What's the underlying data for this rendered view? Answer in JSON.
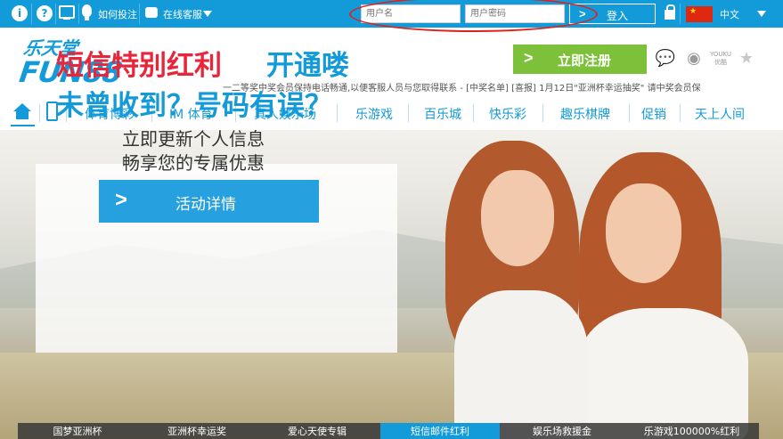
{
  "topbar": {
    "howto_label": "如何投注",
    "support_label": "在线客服",
    "username_placeholder": "用户名",
    "password_placeholder": "用户密码",
    "login_label": "登入",
    "language_label": "中文"
  },
  "header": {
    "logo_top": "乐天堂",
    "logo_main": "FUN88",
    "register_label": "立即注册",
    "youku_label": "YOUKU\n优酷",
    "marquee": "一二等奖中奖会员保持电话畅通,以便客服人员与您取得联系 - [中奖名单]      [喜报] 1月12日\"亚洲杯幸运抽奖\" 请中奖会员保"
  },
  "nav": {
    "items": [
      "体育博彩",
      "IM 体育",
      "真人娱乐场",
      "乐游戏",
      "百乐城",
      "快乐彩",
      "趣乐棋牌",
      "促销",
      "天上人间"
    ]
  },
  "banner": {
    "headline_red": "短信特别红利",
    "headline_blue1": "开通喽",
    "headline_blue2": "未曾收到？号码有误？",
    "sub1": "立即更新个人信息",
    "sub2": "畅享您的专属优惠",
    "cta_label": "活动详情"
  },
  "tabs": {
    "items": [
      "国梦亚洲杯",
      "亚洲杯幸运奖",
      "爱心天使专辑",
      "短信邮件红利",
      "娱乐场救援金",
      "乐游戏100000%红利"
    ],
    "active_index": 3
  },
  "colors": {
    "brand": "#139ad9",
    "register": "#7cc139",
    "accent_red": "#e8263b",
    "oval": "#e0201c"
  }
}
